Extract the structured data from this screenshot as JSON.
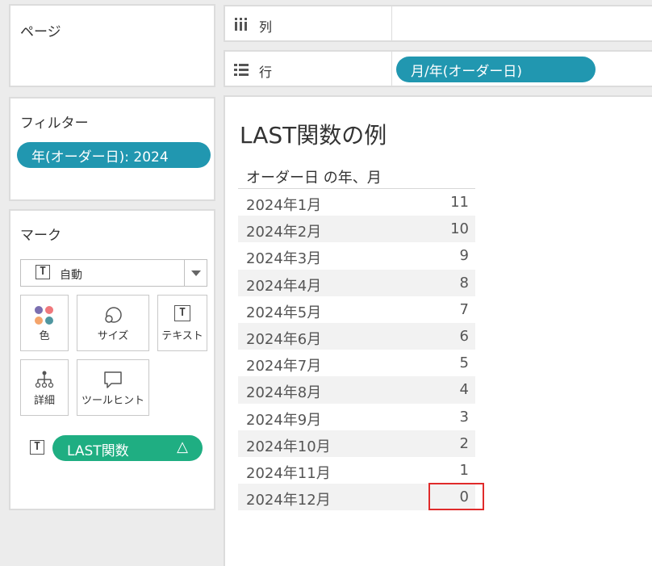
{
  "pages": {
    "title": "ページ"
  },
  "filters": {
    "title": "フィルター",
    "pill": "年(オーダー日): 2024"
  },
  "marks": {
    "title": "マーク",
    "type_label": "自動",
    "cards": {
      "color": "色",
      "size": "サイズ",
      "text": "テキスト",
      "detail": "詳細",
      "tooltip": "ツールヒント"
    },
    "field_pill": "LAST関数",
    "field_pill_delta": "△",
    "colors": {
      "dot1": "#7b6fb0",
      "dot2": "#f0787c",
      "dot3": "#f4a46b",
      "dot4": "#4f96a0"
    }
  },
  "shelves": {
    "columns_label": "列",
    "rows_label": "行",
    "rows_pill": "月/年(オーダー日)"
  },
  "view": {
    "title": "LAST関数の例",
    "column_header": "オーダー日 の年、月",
    "rows": [
      {
        "month": "2024年1月",
        "value": "11"
      },
      {
        "month": "2024年2月",
        "value": "10"
      },
      {
        "month": "2024年3月",
        "value": "9"
      },
      {
        "month": "2024年4月",
        "value": "8"
      },
      {
        "month": "2024年5月",
        "value": "7"
      },
      {
        "month": "2024年6月",
        "value": "6"
      },
      {
        "month": "2024年7月",
        "value": "5"
      },
      {
        "month": "2024年8月",
        "value": "4"
      },
      {
        "month": "2024年9月",
        "value": "3"
      },
      {
        "month": "2024年10月",
        "value": "2"
      },
      {
        "month": "2024年11月",
        "value": "1"
      },
      {
        "month": "2024年12月",
        "value": "0"
      }
    ]
  },
  "theme": {
    "teal_pill": "#2197b0",
    "green_pill": "#1fae82",
    "highlight": "#e02b2b"
  }
}
